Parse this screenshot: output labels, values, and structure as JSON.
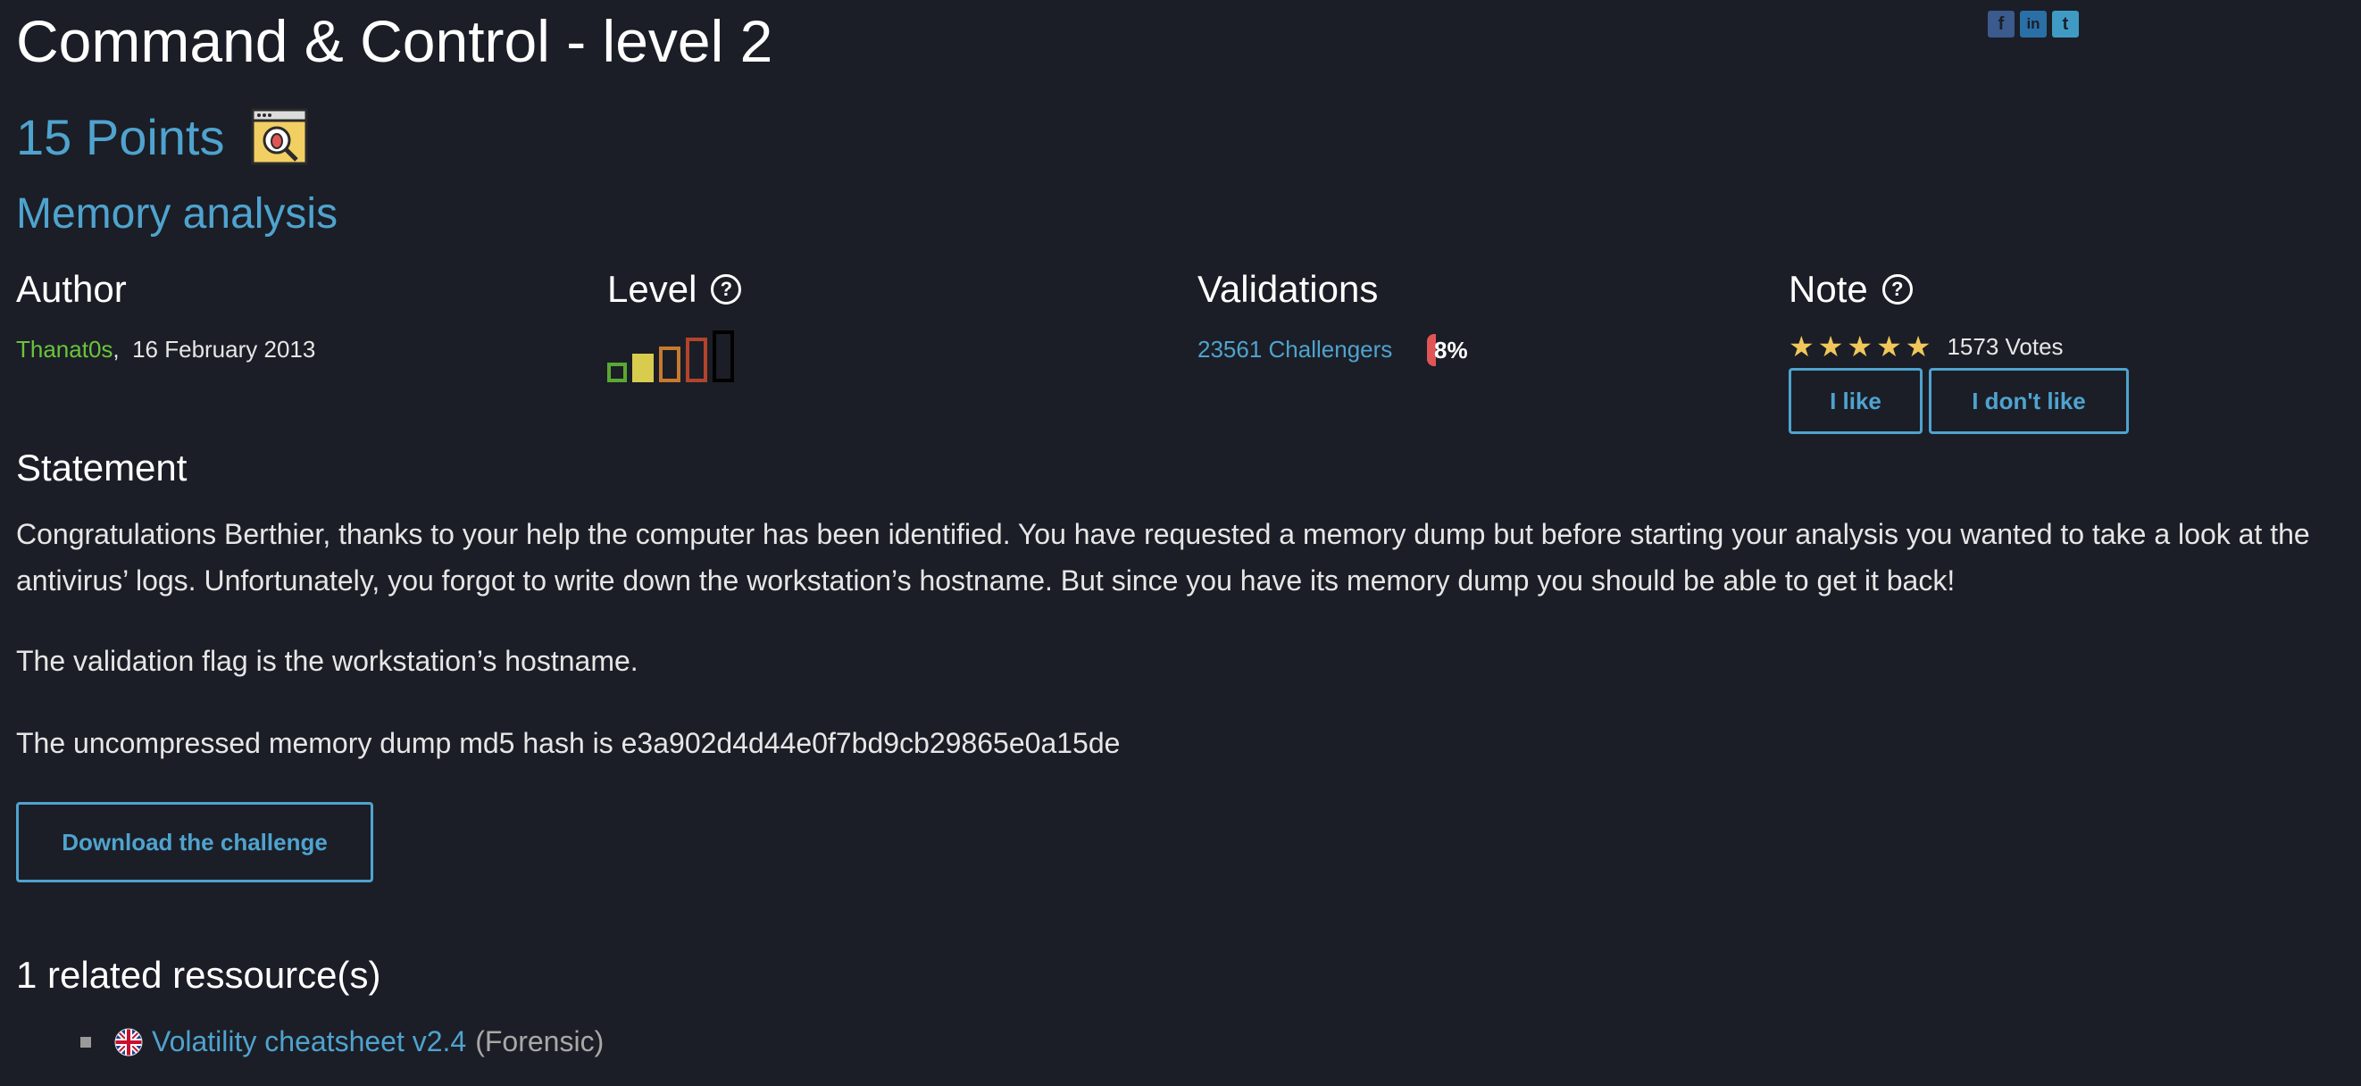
{
  "challenge": {
    "title": "Command & Control - level 2",
    "points": "15 Points",
    "category": "Memory analysis",
    "category_icon": "bug-search-icon"
  },
  "social": {
    "facebook": "f",
    "linkedin": "in",
    "twitter": "t"
  },
  "author": {
    "heading": "Author",
    "name": "Thanat0s",
    "date": "16 February 2013"
  },
  "level": {
    "heading": "Level",
    "value": 2,
    "max": 5
  },
  "validations": {
    "heading": "Validations",
    "challengers": "23561 Challengers",
    "percent": "8%",
    "percent_value": 8
  },
  "note": {
    "heading": "Note",
    "stars": 5,
    "votes": "1573 Votes",
    "like_label": "I like",
    "dislike_label": "I don't like"
  },
  "statement": {
    "heading": "Statement",
    "paragraph1": "Congratulations Berthier, thanks to your help the computer has been identified. You have requested a memory dump but before starting your analysis you wanted to take a look at the antivirus’ logs. Unfortunately, you forgot to write down the workstation’s hostname. But since you have its memory dump you should be able to get it back!",
    "paragraph2": "The validation flag is the workstation’s hostname.",
    "paragraph3": "The uncompressed memory dump md5 hash is e3a902d4d44e0f7bd9cb29865e0a15de"
  },
  "download": {
    "label": "Download the challenge"
  },
  "resources": {
    "heading": "1 related ressource(s)",
    "items": [
      {
        "link": "Volatility cheatsheet v2.4",
        "category": "(Forensic)",
        "flag_icon": "uk-flag-icon"
      }
    ]
  },
  "colors": {
    "background": "#1b1e26",
    "accent": "#4fa3cf",
    "author": "#6ac43c",
    "star": "#f0c75a",
    "percent_badge": "#e05555"
  }
}
